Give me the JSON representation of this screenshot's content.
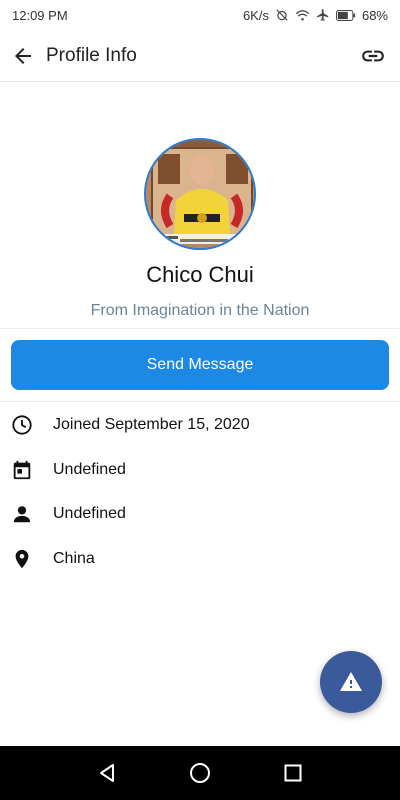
{
  "status_bar": {
    "time": "12:09 PM",
    "network_speed": "6K/s",
    "battery": "68%",
    "icons": [
      "alarm-off-icon",
      "wifi-icon",
      "airplane-icon",
      "battery-icon"
    ]
  },
  "app_bar": {
    "title": "Profile Info",
    "back_icon": "arrow-left-icon",
    "link_icon": "link-icon"
  },
  "profile": {
    "name": "Chico Chui",
    "bio": "From Imagination in the Nation"
  },
  "actions": {
    "send_message_label": "Send Message"
  },
  "info": [
    {
      "icon": "clock-icon",
      "text": "Joined September 15, 2020"
    },
    {
      "icon": "calendar-icon",
      "text": "Undefined"
    },
    {
      "icon": "person-icon",
      "text": "Undefined"
    },
    {
      "icon": "location-pin-icon",
      "text": "China"
    }
  ],
  "fab": {
    "icon": "warning-icon"
  },
  "nav_bar": {
    "icons": [
      "back-triangle-icon",
      "home-circle-icon",
      "recents-square-icon"
    ]
  },
  "colors": {
    "accent": "#1e88e5",
    "fab": "#3a5a9c",
    "bio_text": "#6a8499"
  }
}
